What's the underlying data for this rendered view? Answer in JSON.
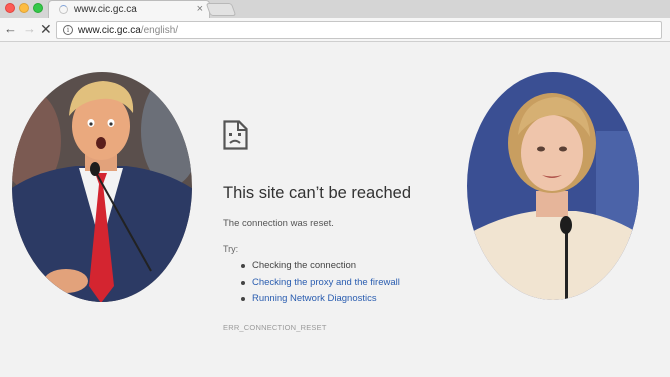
{
  "browser": {
    "tab": {
      "title": "www.cic.gc.ca",
      "close_glyph": "×"
    },
    "nav": {
      "back_glyph": "←",
      "forward_glyph": "→",
      "stop_glyph": "✕"
    },
    "address": {
      "host": "www.cic.gc.ca",
      "path": "/english/",
      "info_glyph": "i"
    }
  },
  "error_page": {
    "icon": "sad-document-icon",
    "title": "This site can’t be reached",
    "subtitle": "The connection was reset.",
    "try_label": "Try:",
    "suggestions": [
      {
        "label": "Checking the connection",
        "link": false
      },
      {
        "label": "Checking the proxy and the firewall",
        "link": true
      },
      {
        "label": "Running Network Diagnostics",
        "link": true
      }
    ],
    "error_code": "ERR_CONNECTION_RESET"
  },
  "colors": {
    "page_background": "#f2f2f2",
    "link": "#2a5db0",
    "title_text": "#333333"
  }
}
